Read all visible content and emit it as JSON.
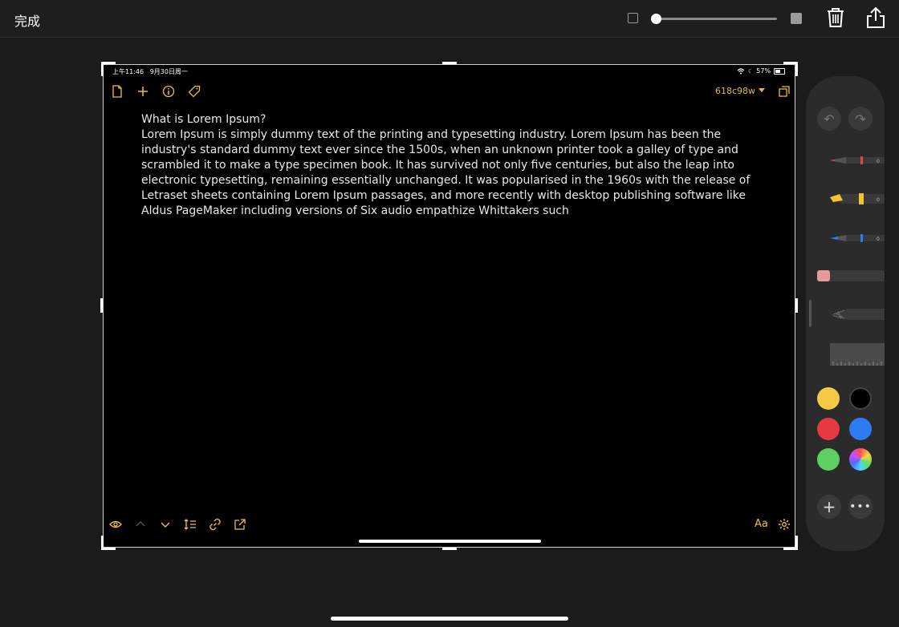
{
  "topbar": {
    "done_label": "完成"
  },
  "status": {
    "time": "上午11:46",
    "date": "9月30日周一",
    "battery": "57%"
  },
  "toolbar": {
    "version_label": "618c98w"
  },
  "note": {
    "title": "What is Lorem Ipsum?",
    "body": "Lorem Ipsum is simply dummy text of the printing and typesetting industry. Lorem Ipsum has been the industry's standard dummy text ever since the 1500s, when an unknown printer took a galley of type and scrambled it to make a type specimen book. It has survived not only five centuries, but also the leap into electronic typesetting, remaining essentially unchanged. It was popularised in the 1960s with the release of Letraset sheets containing Lorem Ipsum passages, and more recently with desktop publishing software like Aldus PageMaker including versions of Six audio empathize Whittakers such"
  },
  "bottom": {
    "font_label": "Aa"
  },
  "colors": {
    "accent": "#e6b84c",
    "swatches": [
      "#f6c945",
      "#000000",
      "#e53a40",
      "#2f7bf5",
      "#5ecf62",
      "multicolor"
    ]
  },
  "icons": [
    "trash-icon",
    "share-icon",
    "doc-icon",
    "plus-icon",
    "info-icon",
    "tag-icon",
    "expand-icon",
    "eye-icon",
    "chevron-up-icon",
    "chevron-down-icon",
    "list-icon",
    "link-icon",
    "export-icon",
    "gear-icon",
    "undo-icon",
    "redo-icon",
    "more-icon"
  ]
}
